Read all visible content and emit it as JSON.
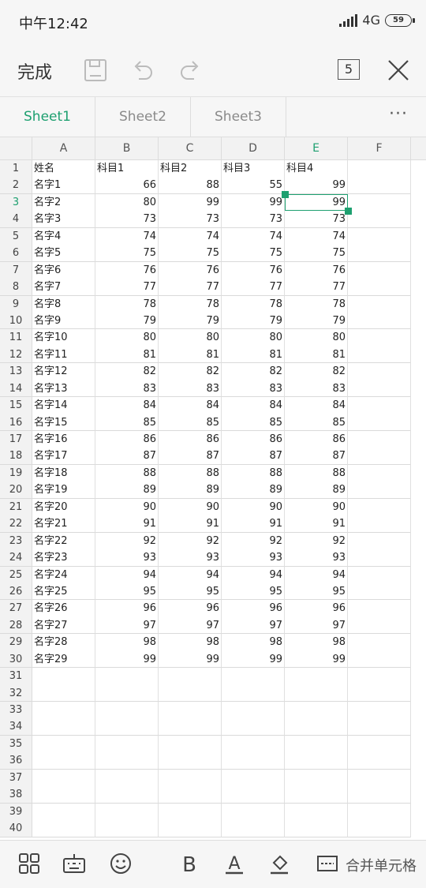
{
  "status": {
    "time": "中午12:42",
    "network": "4G",
    "battery": "59"
  },
  "toolbar": {
    "done_label": "完成",
    "sheet_count": "5"
  },
  "tabs": [
    {
      "label": "Sheet1",
      "active": true
    },
    {
      "label": "Sheet2",
      "active": false
    },
    {
      "label": "Sheet3",
      "active": false
    }
  ],
  "more_label": "···",
  "columns": [
    "A",
    "B",
    "C",
    "D",
    "E",
    "F"
  ],
  "selected": {
    "column": "E",
    "row": "3"
  },
  "header_row": [
    "姓名",
    "科目1",
    "科目2",
    "科目3",
    "科目4"
  ],
  "rows": [
    [
      "名字1",
      66,
      88,
      55,
      99
    ],
    [
      "名字2",
      80,
      99,
      99,
      99
    ],
    [
      "名字3",
      73,
      73,
      73,
      73
    ],
    [
      "名字4",
      74,
      74,
      74,
      74
    ],
    [
      "名字5",
      75,
      75,
      75,
      75
    ],
    [
      "名字6",
      76,
      76,
      76,
      76
    ],
    [
      "名字7",
      77,
      77,
      77,
      77
    ],
    [
      "名字8",
      78,
      78,
      78,
      78
    ],
    [
      "名字9",
      79,
      79,
      79,
      79
    ],
    [
      "名字10",
      80,
      80,
      80,
      80
    ],
    [
      "名字11",
      81,
      81,
      81,
      81
    ],
    [
      "名字12",
      82,
      82,
      82,
      82
    ],
    [
      "名字13",
      83,
      83,
      83,
      83
    ],
    [
      "名字14",
      84,
      84,
      84,
      84
    ],
    [
      "名字15",
      85,
      85,
      85,
      85
    ],
    [
      "名字16",
      86,
      86,
      86,
      86
    ],
    [
      "名字17",
      87,
      87,
      87,
      87
    ],
    [
      "名字18",
      88,
      88,
      88,
      88
    ],
    [
      "名字19",
      89,
      89,
      89,
      89
    ],
    [
      "名字20",
      90,
      90,
      90,
      90
    ],
    [
      "名字21",
      91,
      91,
      91,
      91
    ],
    [
      "名字22",
      92,
      92,
      92,
      92
    ],
    [
      "名字23",
      93,
      93,
      93,
      93
    ],
    [
      "名字24",
      94,
      94,
      94,
      94
    ],
    [
      "名字25",
      95,
      95,
      95,
      95
    ],
    [
      "名字26",
      96,
      96,
      96,
      96
    ],
    [
      "名字27",
      97,
      97,
      97,
      97
    ],
    [
      "名字28",
      98,
      98,
      98,
      98
    ],
    [
      "名字29",
      99,
      99,
      99,
      99
    ]
  ],
  "total_rows": 40,
  "bottom_bar": {
    "icons": [
      "apps-icon",
      "keyboard-icon",
      "emoji-icon",
      "bold-icon",
      "font-color-icon",
      "fill-color-icon",
      "merge-cells-icon"
    ],
    "merge_label": "合并单元格"
  },
  "colors": {
    "accent": "#1ea070"
  }
}
